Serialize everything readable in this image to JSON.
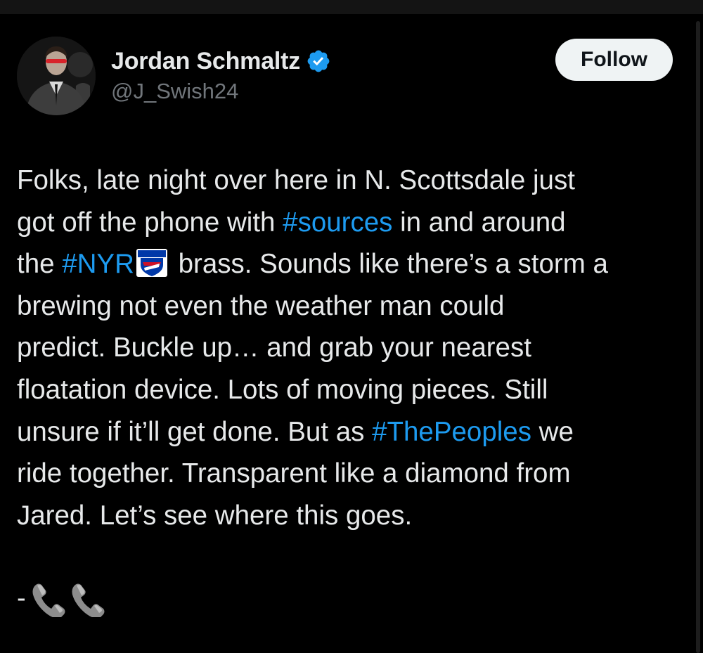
{
  "author": {
    "name": "Jordan Schmaltz",
    "handle": "@J_Swish24",
    "verified_icon": "verified-badge-icon",
    "avatar_icon": "profile-photo"
  },
  "follow_button": {
    "label": "Follow"
  },
  "tweet": {
    "lines": [
      [
        {
          "text": "Folks, late night over here in N. Scottsdale just"
        }
      ],
      [
        {
          "text": "got off the phone with "
        },
        {
          "text": "#sources",
          "tag": true
        },
        {
          "text": " in and around"
        }
      ],
      [
        {
          "text": "the "
        },
        {
          "text": "#NYR",
          "tag": true
        },
        {
          "emoji": "rangers-logo-icon"
        },
        {
          "text": " brass. Sounds like there’s a storm a"
        }
      ],
      [
        {
          "text": "brewing  not even the weather man could"
        }
      ],
      [
        {
          "text": "predict. Buckle up… and grab your nearest"
        }
      ],
      [
        {
          "text": "floatation device. Lots of moving pieces. Still"
        }
      ],
      [
        {
          "text": "unsure if it’ll get done. But as "
        },
        {
          "text": "#ThePeoples",
          "tag": true
        },
        {
          "text": " we"
        }
      ],
      [
        {
          "text": "ride together. Transparent like a diamond from"
        }
      ],
      [
        {
          "text": "Jared. Let’s see where this goes."
        }
      ]
    ],
    "signoff": {
      "dash": "-",
      "icons": [
        "telephone-icon",
        "telephone-icon"
      ]
    }
  },
  "colors": {
    "background": "#000000",
    "text": "#e7e9ea",
    "handle": "#71767b",
    "link": "#1d9bf0",
    "verified": "#1d9bf0",
    "button_bg": "#eff3f4",
    "button_text": "#0f1419"
  }
}
